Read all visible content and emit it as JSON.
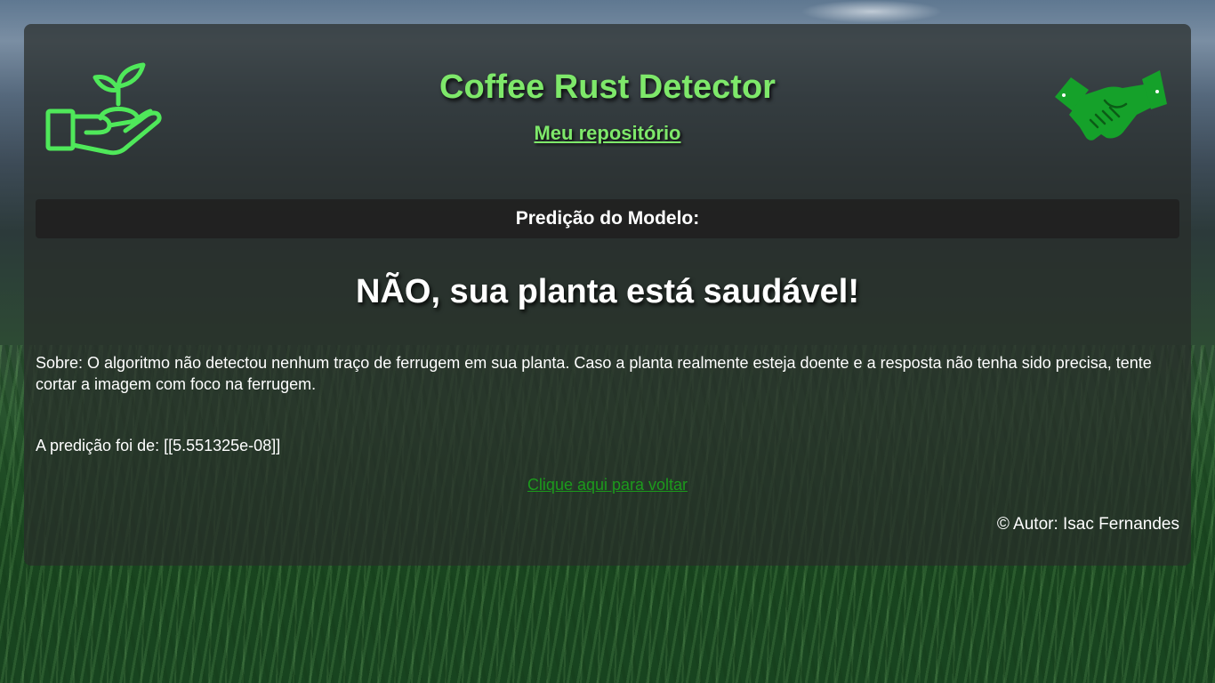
{
  "header": {
    "title": "Coffee Rust Detector",
    "repo_link_label": "Meu repositório"
  },
  "icons": {
    "left_logo": "hand-holding-plant-icon",
    "right_logo": "handshake-icon"
  },
  "section": {
    "heading": "Predição do Modelo:"
  },
  "result": {
    "headline": "NÃO, sua planta está saudável!",
    "about": "Sobre: O algoritmo não detectou nenhum traço de ferrugem em sua planta. Caso a planta realmente esteja doente e a resposta não tenha sido precisa, tente cortar a imagem com foco na ferrugem.",
    "prediction": "A predição foi de: [[5.551325e-08]]"
  },
  "footer": {
    "back_link_label": "Clique aqui para voltar",
    "author": "© Autor: Isac Fernandes"
  },
  "colors": {
    "title_green": "#7ee86a",
    "link_green": "#1c9a1c",
    "handshake_green": "#15a12a",
    "panel_bg": "#282d2a"
  }
}
